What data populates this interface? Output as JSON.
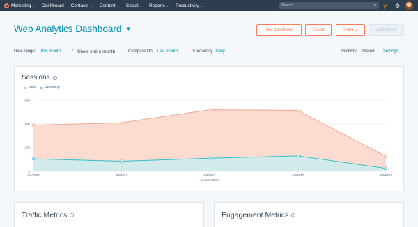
{
  "nav": {
    "brand_label": "Marketing",
    "items": [
      {
        "label": "Dashboard",
        "has_caret": false
      },
      {
        "label": "Contacts",
        "has_caret": true
      },
      {
        "label": "Content",
        "has_caret": true
      },
      {
        "label": "Social",
        "has_caret": true
      },
      {
        "label": "Reports",
        "has_caret": true
      },
      {
        "label": "Productivity",
        "has_caret": true
      }
    ],
    "search_placeholder": "Search",
    "caret": "⌄"
  },
  "header": {
    "title": "Web Analytics Dashboard",
    "buttons": {
      "new_dashboard": "New dashboard",
      "export": "Export",
      "share": "Share",
      "add_report": "Add report"
    }
  },
  "filters": {
    "date_range_label": "Date range:",
    "date_range_value": "This month",
    "show_entire_month_label": "Show entire month",
    "show_entire_month_checked": true,
    "compared_to_label": "Compared to:",
    "compared_to_value": "Last month",
    "frequency_label": "Frequency",
    "frequency_value": "Daily",
    "visibility_label": "Visibility:",
    "visibility_value": "Shared",
    "settings_label": "Settings"
  },
  "sessions_card": {
    "title": "Sessions",
    "info_glyph": "i"
  },
  "traffic_card": {
    "title": "Traffic Metrics",
    "info_glyph": "i"
  },
  "engagement_card": {
    "title": "Engagement Metrics",
    "info_glyph": "i"
  },
  "colors": {
    "new": "#f2a58e",
    "new_fill": "#fbd6c8",
    "returning": "#35bfc7",
    "returning_fill": "#c9ecee",
    "grid": "#eaeef3",
    "axis_text": "#516f90"
  },
  "chart_data": {
    "type": "area",
    "title": "Sessions",
    "xlabel": "Session Date",
    "ylabel": "",
    "x": [
      "4/1/2017",
      "4/2/2017",
      "4/3/2017",
      "4/4/2017",
      "4/5/2017"
    ],
    "series": [
      {
        "name": "New",
        "values": [
          390,
          410,
          520,
          515,
          125
        ]
      },
      {
        "name": "Returning",
        "values": [
          105,
          85,
          110,
          130,
          25
        ]
      }
    ],
    "ylim": [
      0,
      600
    ],
    "yticks": [
      0,
      200,
      400,
      600
    ],
    "grid": true,
    "legend_position": "top-left",
    "stacked": false
  }
}
